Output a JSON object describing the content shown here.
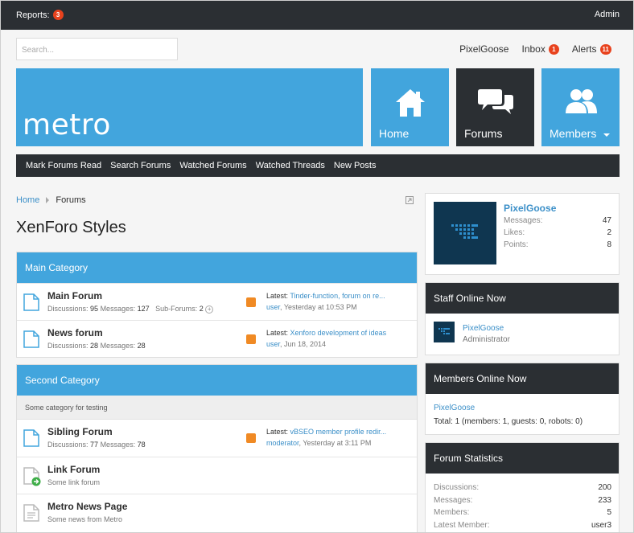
{
  "topbar": {
    "reports_label": "Reports:",
    "reports_count": "3",
    "admin_label": "Admin"
  },
  "search": {
    "placeholder": "Search..."
  },
  "userlinks": {
    "username": "PixelGoose",
    "inbox_label": "Inbox",
    "inbox_count": "1",
    "alerts_label": "Alerts",
    "alerts_count": "11"
  },
  "logo": {
    "text": "metro"
  },
  "tiles": {
    "home": "Home",
    "forums": "Forums",
    "members": "Members"
  },
  "nav": [
    "Mark Forums Read",
    "Search Forums",
    "Watched Forums",
    "Watched Threads",
    "New Posts"
  ],
  "breadcrumb": {
    "home": "Home",
    "current": "Forums"
  },
  "page_title": "XenForo Styles",
  "categories": [
    {
      "title": "Main Category",
      "forums": [
        {
          "title": "Main Forum",
          "discussions_label": "Discussions:",
          "discussions": "95",
          "messages_label": "Messages:",
          "messages": "127",
          "subforums_label": "Sub-Forums:",
          "subforums": "2",
          "latest_label": "Latest:",
          "latest_title": "Tinder-function, forum on re...",
          "latest_user": "user",
          "latest_date": ", Yesterday at 10:53 PM"
        },
        {
          "title": "News forum",
          "discussions_label": "Discussions:",
          "discussions": "28",
          "messages_label": "Messages:",
          "messages": "28",
          "latest_label": "Latest:",
          "latest_title": "Xenforo development of ideas",
          "latest_user": "user",
          "latest_date": ", Jun 18, 2014"
        }
      ]
    },
    {
      "title": "Second Category",
      "description": "Some category for testing",
      "forums": [
        {
          "title": "Sibling Forum",
          "discussions_label": "Discussions:",
          "discussions": "77",
          "messages_label": "Messages:",
          "messages": "78",
          "latest_label": "Latest:",
          "latest_title": "vBSEO member profile redir...",
          "latest_user": "moderator",
          "latest_date": ", Yesterday at 3:11 PM"
        },
        {
          "title": "Link Forum",
          "subtitle": "Some link forum"
        },
        {
          "title": "Metro News Page",
          "subtitle": "Some news from Metro"
        }
      ]
    }
  ],
  "profile": {
    "name": "PixelGoose",
    "messages_label": "Messages:",
    "messages": "47",
    "likes_label": "Likes:",
    "likes": "2",
    "points_label": "Points:",
    "points": "8"
  },
  "staff": {
    "title": "Staff Online Now",
    "name": "PixelGoose",
    "role": "Administrator"
  },
  "members_online": {
    "title": "Members Online Now",
    "name": "PixelGoose",
    "total": "Total: 1 (members: 1, guests: 0, robots: 0)"
  },
  "forum_stats": {
    "title": "Forum Statistics",
    "discussions_label": "Discussions:",
    "discussions": "200",
    "messages_label": "Messages:",
    "messages": "233",
    "members_label": "Members:",
    "members": "5",
    "latest_label": "Latest Member:",
    "latest": "user3"
  },
  "colors": {
    "accent": "#42a5dd",
    "dark": "#2b2f33",
    "badge": "#e8421d",
    "rss": "#f08a24",
    "link": "#3b8fc8"
  }
}
